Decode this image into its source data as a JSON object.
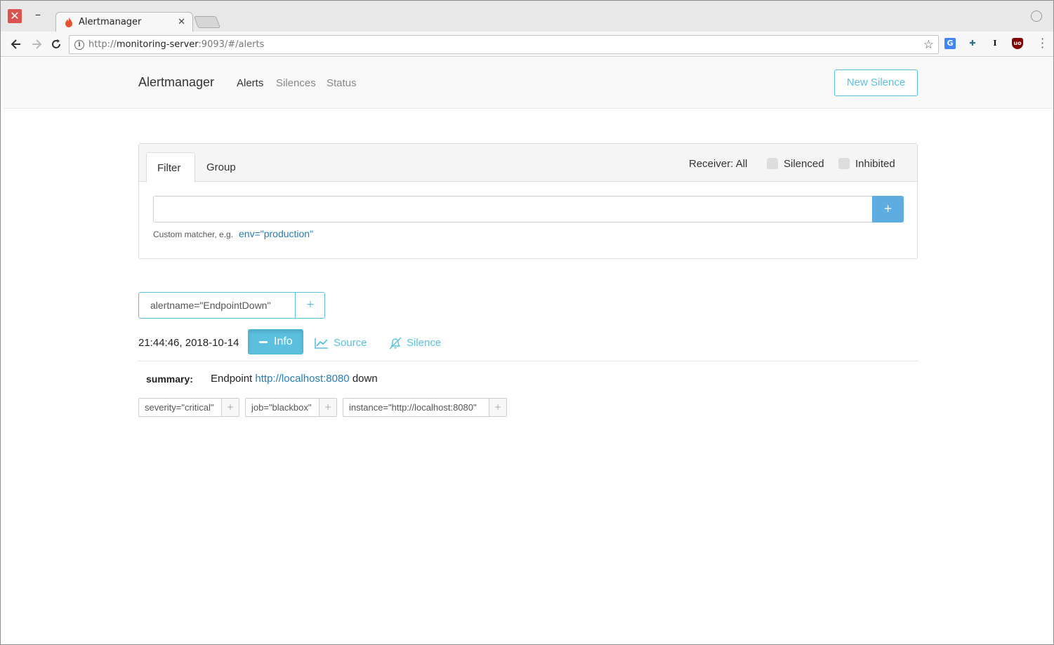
{
  "browser": {
    "tab_title": "Alertmanager",
    "url_scheme": "http://",
    "url_host": "monitoring-server",
    "url_rest": ":9093/#/alerts"
  },
  "navbar": {
    "brand": "Alertmanager",
    "links": [
      "Alerts",
      "Silences",
      "Status"
    ],
    "new_silence": "New Silence"
  },
  "filter_card": {
    "tabs": [
      "Filter",
      "Group"
    ],
    "receiver": "Receiver: All",
    "silenced": "Silenced",
    "inhibited": "Inhibited",
    "add": "+",
    "hint": "Custom matcher, e.g.",
    "hint_example": "env=\"production\""
  },
  "group": {
    "tag": "alertname=\"EndpointDown\"",
    "add": "+"
  },
  "alert": {
    "time": "21:44:46, 2018-10-14",
    "info": "Info",
    "source": "Source",
    "silence": "Silence",
    "summary_key": "summary:",
    "summary_prefix": "Endpoint ",
    "summary_link": "http://localhost:8080",
    "summary_suffix": " down",
    "labels": [
      "severity=\"critical\"",
      "job=\"blackbox\"",
      "instance=\"http://localhost:8080\""
    ],
    "label_add": "+"
  },
  "colors": {
    "accent": "#5bc0de",
    "primary": "#5dade2",
    "link": "#2a7ab0"
  }
}
